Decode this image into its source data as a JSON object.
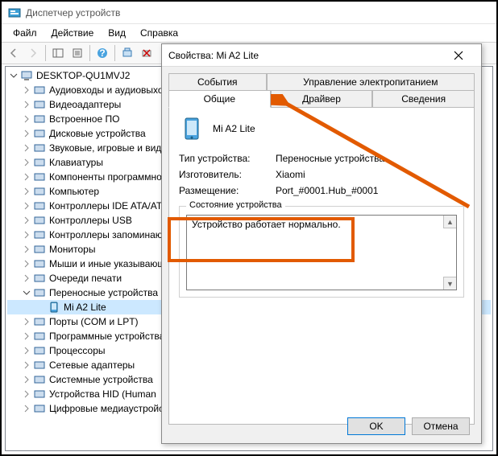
{
  "window": {
    "title": "Диспетчер устройств"
  },
  "menu": {
    "file": "Файл",
    "action": "Действие",
    "view": "Вид",
    "help": "Справка"
  },
  "tree": {
    "root": "DESKTOP-QU1MVJ2",
    "items": [
      "Аудиовходы и аудиовыходы",
      "Видеоадаптеры",
      "Встроенное ПО",
      "Дисковые устройства",
      "Звуковые, игровые и видео",
      "Клавиатуры",
      "Компоненты программного",
      "Компьютер",
      "Контроллеры IDE ATA/ATAPI",
      "Контроллеры USB",
      "Контроллеры запоминающих",
      "Мониторы",
      "Мыши и иные указывающие",
      "Очереди печати",
      "Переносные устройства",
      "Порты (COM и LPT)",
      "Программные устройства",
      "Процессоры",
      "Сетевые адаптеры",
      "Системные устройства",
      "Устройства HID (Human",
      "Цифровые медиаустройства"
    ],
    "child": "Mi A2 Lite"
  },
  "dialog": {
    "title": "Свойства: Mi A2 Lite",
    "tabs": {
      "events": "События",
      "power": "Управление электропитанием",
      "general": "Общие",
      "driver": "Драйвер",
      "details": "Сведения"
    },
    "device": "Mi A2 Lite",
    "rows": {
      "type_lbl": "Тип устройства:",
      "type_val": "Переносные устройства",
      "mfg_lbl": "Изготовитель:",
      "mfg_val": "Xiaomi",
      "loc_lbl": "Размещение:",
      "loc_val": "Port_#0001.Hub_#0001"
    },
    "status_legend": "Состояние устройства",
    "status_text": "Устройство работает нормально.",
    "ok": "OK",
    "cancel": "Отмена"
  }
}
